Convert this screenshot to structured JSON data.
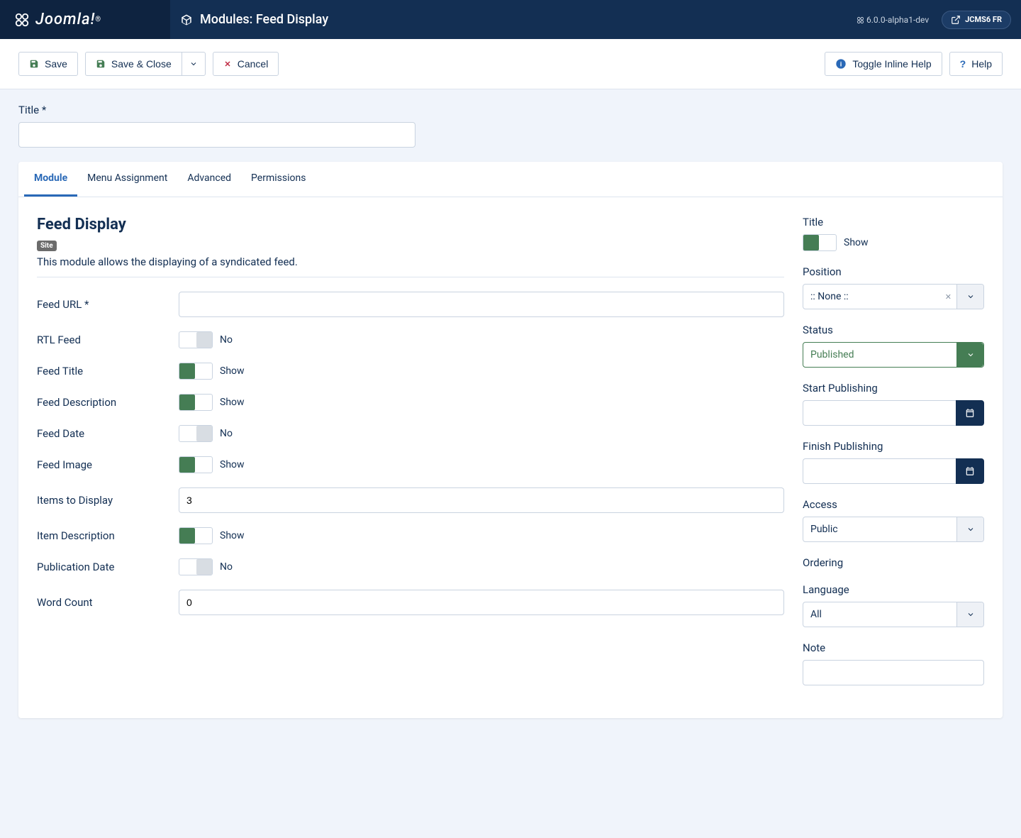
{
  "brand": "Joomla!",
  "page_title": "Modules: Feed Display",
  "version": "6.0.0-alpha1-dev",
  "site_name": "JCMS6 FR",
  "toolbar": {
    "save": "Save",
    "save_close": "Save & Close",
    "cancel": "Cancel",
    "toggle_inline_help": "Toggle Inline Help",
    "help": "Help"
  },
  "title_label": "Title *",
  "title_value": "",
  "tabs": [
    "Module",
    "Menu Assignment",
    "Advanced",
    "Permissions"
  ],
  "module": {
    "heading": "Feed Display",
    "badge": "Site",
    "description": "This module allows the displaying of a syndicated feed.",
    "fields": {
      "feed_url_label": "Feed URL *",
      "feed_url_value": "",
      "rtl_feed_label": "RTL Feed",
      "feed_title_label": "Feed Title",
      "feed_description_label": "Feed Description",
      "feed_date_label": "Feed Date",
      "feed_image_label": "Feed Image",
      "items_to_display_label": "Items to Display",
      "items_to_display_value": "3",
      "item_description_label": "Item Description",
      "publication_date_label": "Publication Date",
      "word_count_label": "Word Count",
      "word_count_value": "0"
    },
    "toggle_labels": {
      "show": "Show",
      "no": "No"
    }
  },
  "sidebar": {
    "title_label": "Title",
    "position_label": "Position",
    "position_value": ":: None ::",
    "status_label": "Status",
    "status_value": "Published",
    "start_publishing_label": "Start Publishing",
    "start_publishing_value": "",
    "finish_publishing_label": "Finish Publishing",
    "finish_publishing_value": "",
    "access_label": "Access",
    "access_value": "Public",
    "ordering_label": "Ordering",
    "language_label": "Language",
    "language_value": "All",
    "note_label": "Note",
    "note_value": ""
  }
}
